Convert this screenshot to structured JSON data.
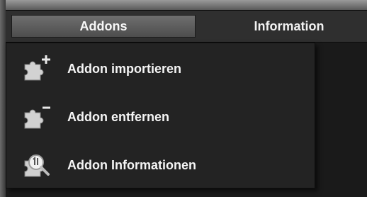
{
  "menubar": {
    "addons_label": "Addons",
    "information_label": "Information"
  },
  "dropdown": {
    "items": [
      {
        "label": "Addon importieren",
        "icon": "puzzle-add-icon"
      },
      {
        "label": "Addon entfernen",
        "icon": "puzzle-remove-icon"
      },
      {
        "label": "Addon Informationen",
        "icon": "puzzle-info-icon"
      }
    ]
  }
}
